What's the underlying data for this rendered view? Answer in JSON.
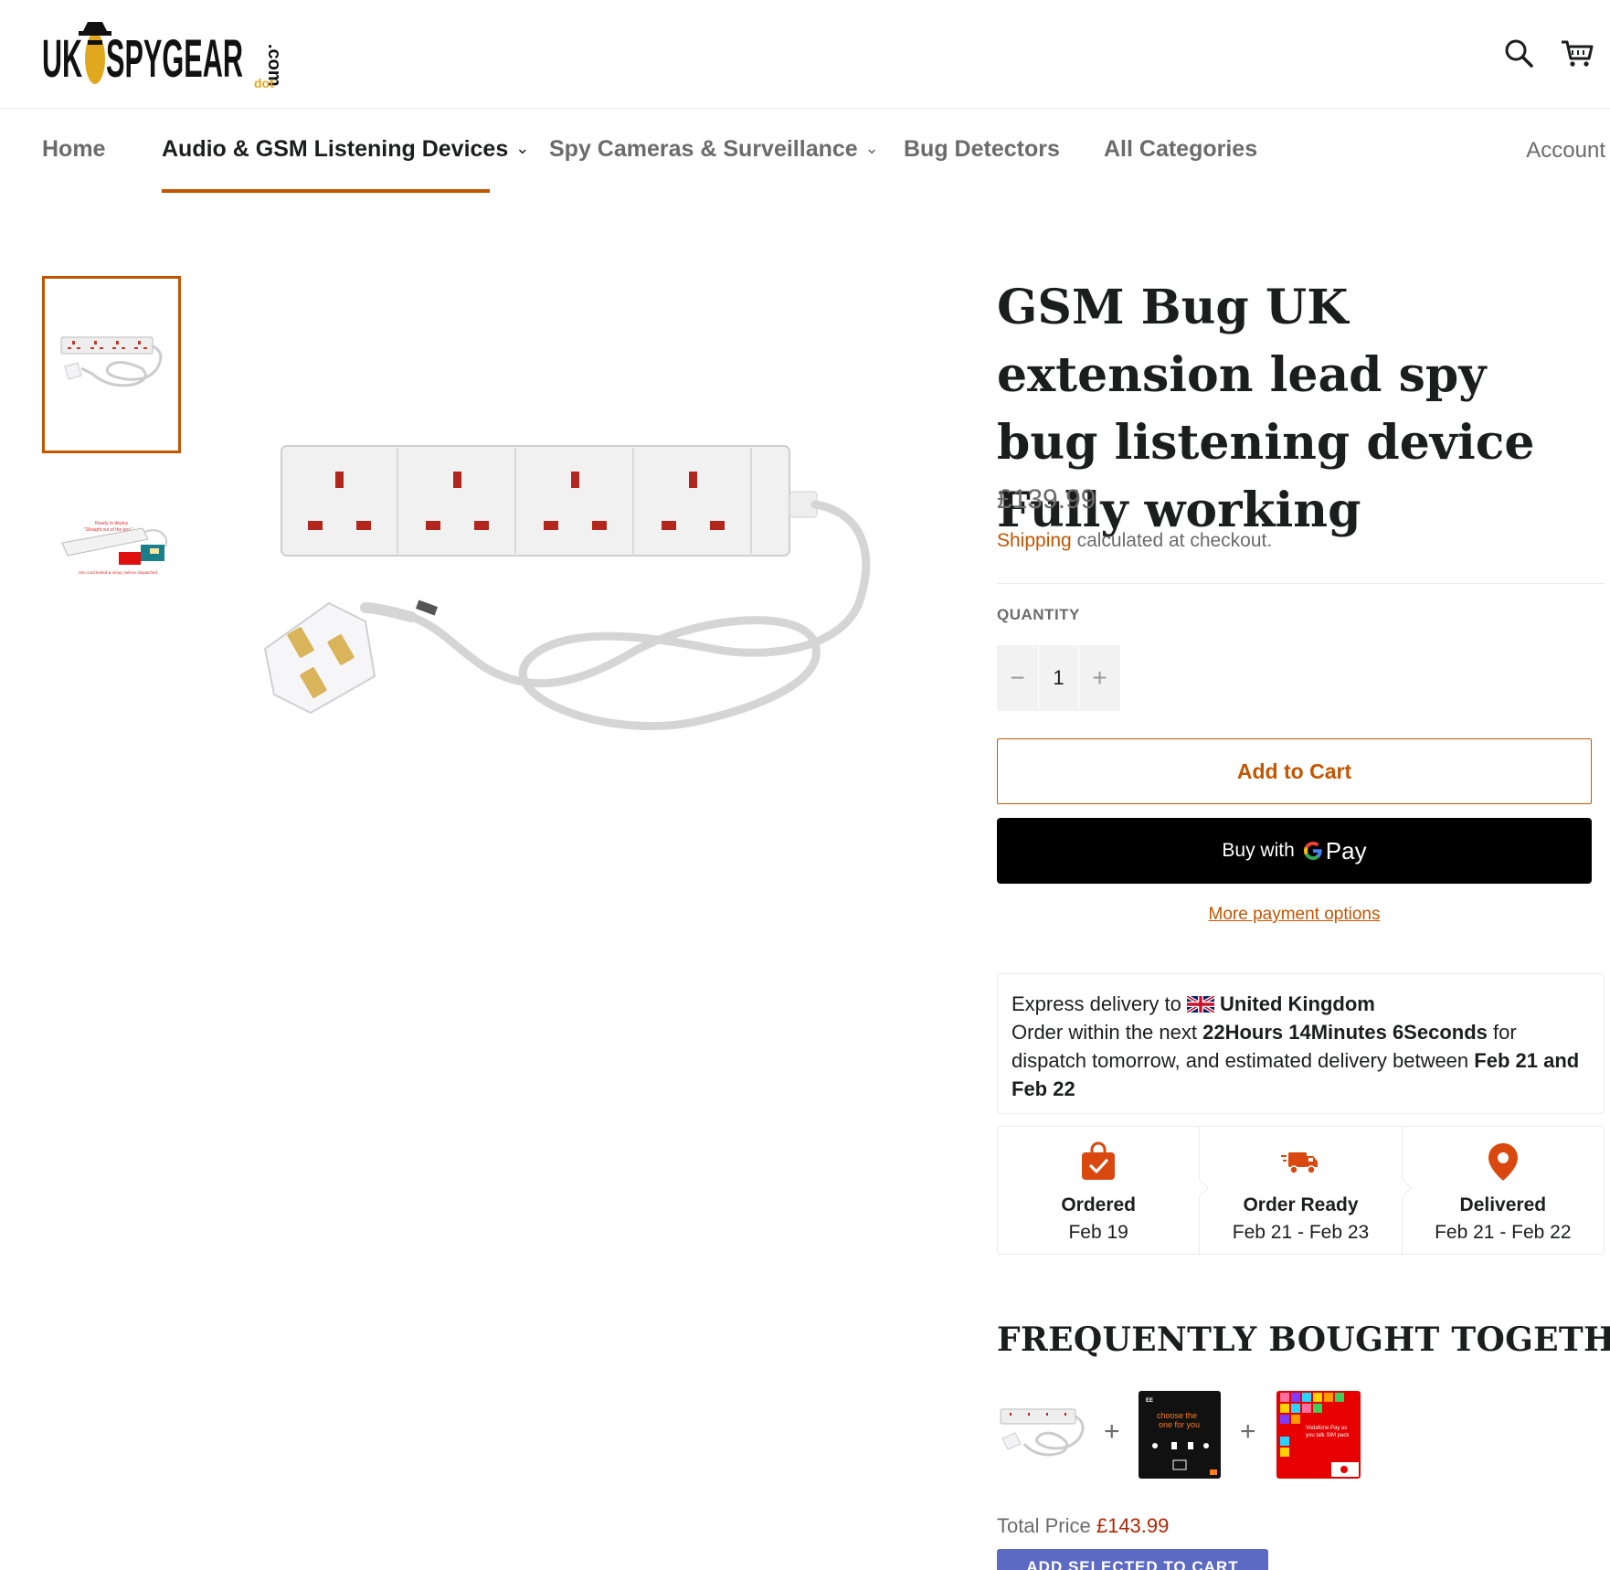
{
  "header": {
    "logo_text": "UK SPYGEAR dot com",
    "search_icon": "search-icon",
    "cart_icon": "cart-icon"
  },
  "nav": {
    "items": [
      {
        "label": "Home",
        "has_dropdown": false,
        "active": false
      },
      {
        "label": "Audio & GSM Listening Devices",
        "has_dropdown": true,
        "active": true
      },
      {
        "label": "Spy Cameras & Surveillance",
        "has_dropdown": true,
        "active": false
      },
      {
        "label": "Bug Detectors",
        "has_dropdown": false,
        "active": false
      },
      {
        "label": "All Categories",
        "has_dropdown": false,
        "active": false
      }
    ],
    "account_label": "Account",
    "accent_color": "#c45500"
  },
  "product": {
    "title": "GSM Bug UK extension lead spy bug listening device Fully working",
    "price": "£139.99",
    "shipping_link": "Shipping",
    "shipping_text": " calculated at checkout.",
    "quantity_label": "QUANTITY",
    "quantity_value": "1",
    "qty_minus": "−",
    "qty_plus": "+",
    "add_to_cart": "Add to Cart",
    "gpay_prefix": "Buy with",
    "gpay_word": "Pay",
    "more_payment": "More payment options"
  },
  "delivery": {
    "line1_prefix": "Express delivery to",
    "country": "United Kingdom",
    "line2_prefix": "Order within the next",
    "countdown": "22Hours 14Minutes 6Seconds",
    "line2_mid": "for dispatch tomorrow, and estimated delivery between",
    "range": "Feb 21 and Feb 22",
    "steps": [
      {
        "title": "Ordered",
        "date": "Feb 19",
        "icon": "shopping-bag-check-icon"
      },
      {
        "title": "Order Ready",
        "date": "Feb 21 - Feb 23",
        "icon": "delivery-truck-icon"
      },
      {
        "title": "Delivered",
        "date": "Feb 21 - Feb 22",
        "icon": "map-pin-icon"
      }
    ],
    "icon_color": "#d9480f"
  },
  "fbt": {
    "title": "FREQUENTLY BOUGHT TOGETHER",
    "plus": "+",
    "total_label": "Total Price",
    "total_amount": "£143.99",
    "add_selected": "ADD SELECTED TO CART",
    "button_color": "#5c6ac4"
  }
}
